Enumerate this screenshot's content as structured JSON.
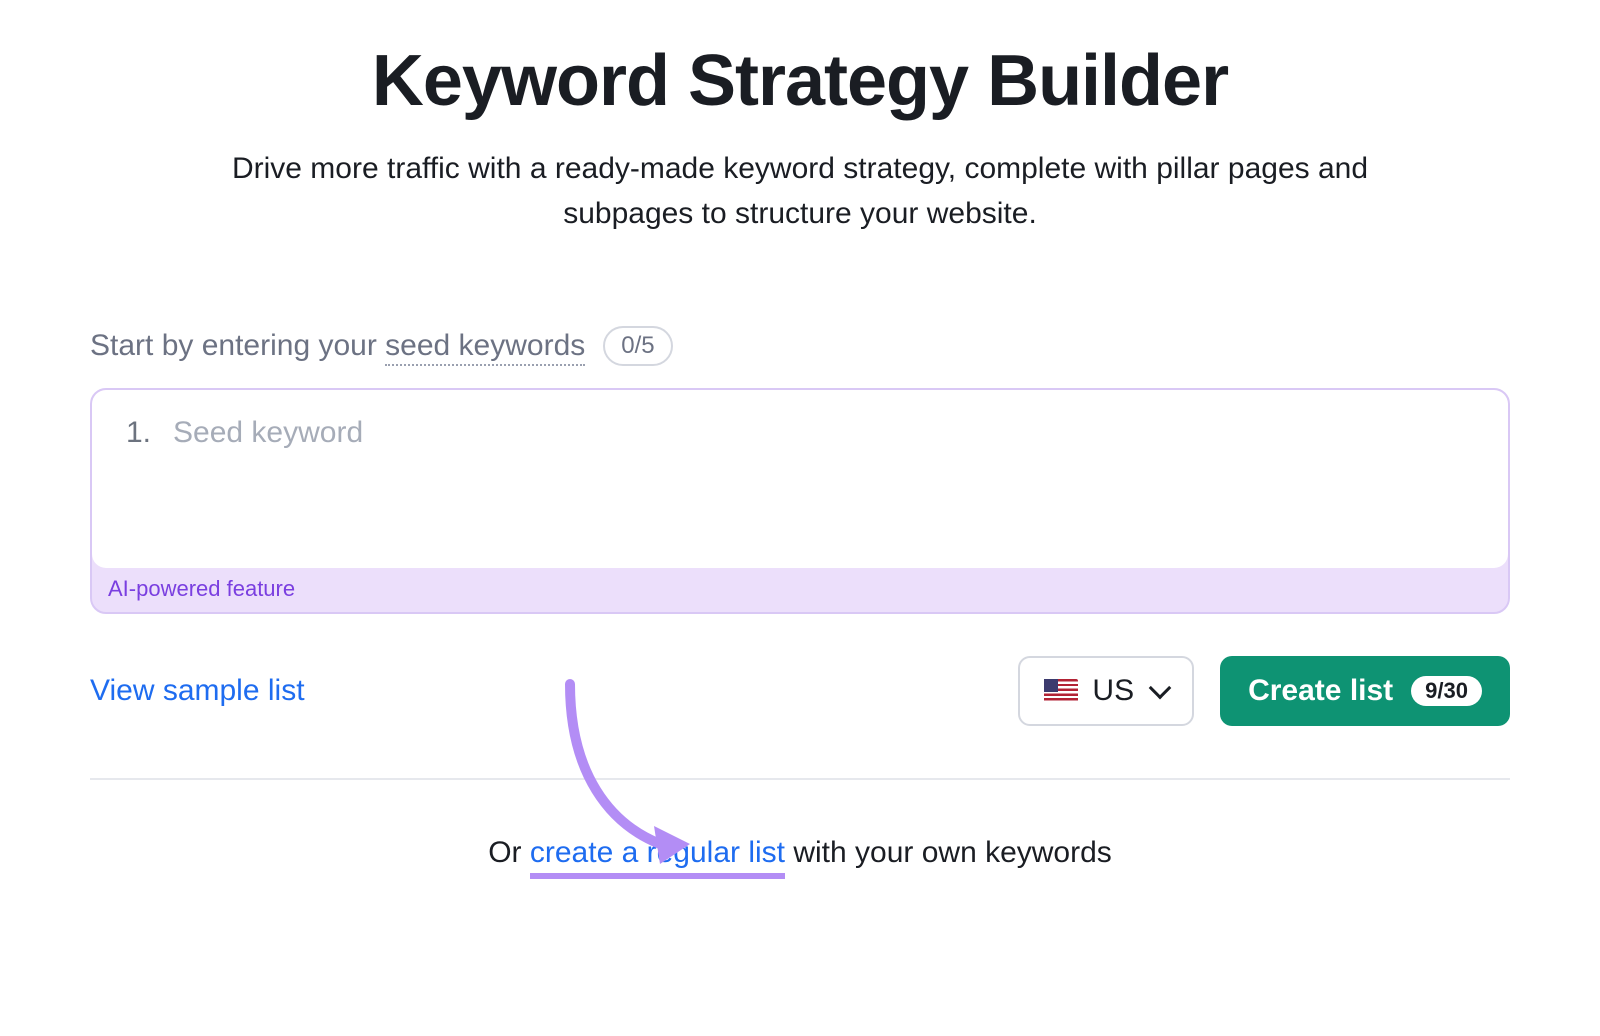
{
  "header": {
    "title": "Keyword Strategy Builder",
    "subtitle": "Drive more traffic with a ready-made keyword strategy, complete with pillar pages and subpages to structure your website."
  },
  "seed": {
    "label_prefix": "Start by entering your ",
    "label_underlined": "seed keywords",
    "count": "0/5",
    "line_number": "1.",
    "placeholder": "Seed keyword",
    "ai_footer": "AI-powered feature"
  },
  "controls": {
    "sample_link": "View sample list",
    "country_label": "US",
    "create_label": "Create list",
    "create_count": "9/30"
  },
  "alt": {
    "prefix": "Or ",
    "link": "create a regular list",
    "suffix": " with your own keywords"
  },
  "colors": {
    "accent_purple": "#b38df5",
    "link_blue": "#1e6cf0",
    "primary_green": "#0e9373",
    "ai_purple_bg": "#ecdffb",
    "ai_purple_text": "#7a3fe0"
  }
}
